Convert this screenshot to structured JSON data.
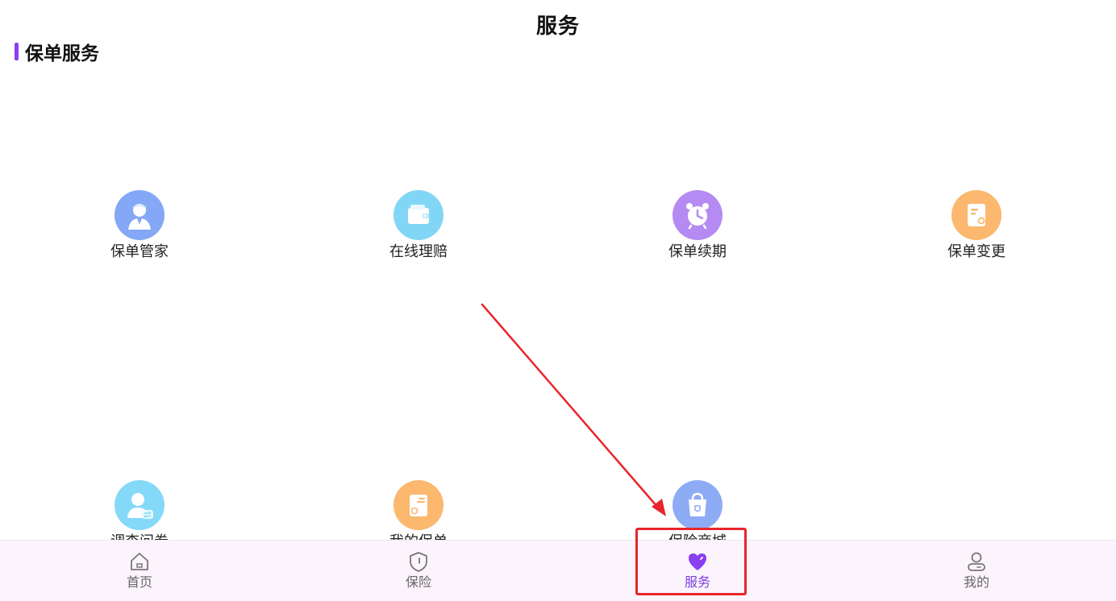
{
  "header": {
    "title": "服务"
  },
  "section": {
    "title": "保单服务"
  },
  "services": [
    {
      "label": "保单管家",
      "icon": "agent-avatar-icon",
      "color": "#84a8f5"
    },
    {
      "label": "在线理赔",
      "icon": "wallet-icon",
      "color": "#82d6f5"
    },
    {
      "label": "保单续期",
      "icon": "alarm-clock-icon",
      "color": "#b58af2"
    },
    {
      "label": "保单变更",
      "icon": "document-edit-icon",
      "color": "#fbb86e"
    },
    {
      "label": "调查问卷",
      "icon": "user-exchange-icon",
      "color": "#85d9f8"
    },
    {
      "label": "我的保单",
      "icon": "policy-card-icon",
      "color": "#fbb86e"
    },
    {
      "label": "保险商城",
      "icon": "shopping-bag-icon",
      "color": "#8eabf6"
    }
  ],
  "tabbar": {
    "items": [
      {
        "label": "首页",
        "icon": "home-icon"
      },
      {
        "label": "保险",
        "icon": "shield-icon"
      },
      {
        "label": "服务",
        "icon": "heart-icon",
        "active": true
      },
      {
        "label": "我的",
        "icon": "user-icon"
      }
    ]
  },
  "colors": {
    "accent": "#8a3ff0",
    "annotation": "#e8252b",
    "tabbar_bg": "#fcf4fc"
  }
}
